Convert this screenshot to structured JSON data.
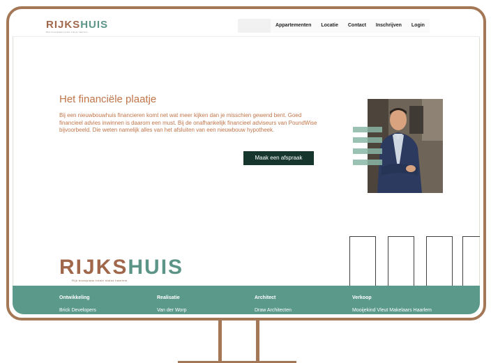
{
  "nav": {
    "logo_word_1": "RIJKS",
    "logo_word_2": "HUIS",
    "logo_tagline": "Rijk bouwplaas totale status haarlem",
    "links": [
      "Appartementen",
      "Locatie",
      "Contact",
      "Inschrijven",
      "Login"
    ]
  },
  "hero": {
    "title": "Het financiële plaatje",
    "text": "Bij een nieuwbouwhuis financieren komt net wat meer kijken dan je misschien gewend bent. Goed financieel advies inwinnen is daarom een must. Bij de onafhankelijk financieel adviseurs van PoundWise bijvoorbeeld. Die weten namelijk alles van het afsluiten van een nieuwbouw hypotheek.",
    "cta": "Maak een afspraak"
  },
  "footer_logo": {
    "word_1": "RIJKS",
    "word_2": "HUIS",
    "tagline": "Rijk bouwplaas totale status haarlem"
  },
  "footer": {
    "columns": [
      {
        "heading": "Ontwikkeling",
        "value": "Brick Developers"
      },
      {
        "heading": "Realisatie",
        "value": "Van der Worp"
      },
      {
        "heading": "Architect",
        "value": "Draw Architecten"
      },
      {
        "heading": "Verkoop",
        "value": "Mooijekind Vleut Makelaars Haarlem"
      }
    ]
  },
  "colors": {
    "frame": "#a47856",
    "brand_brown": "#a0674b",
    "brand_green": "#5c9488",
    "footer_bg": "#5b9a8b",
    "cta_bg": "#16362d",
    "text_accent": "#c0754a"
  }
}
